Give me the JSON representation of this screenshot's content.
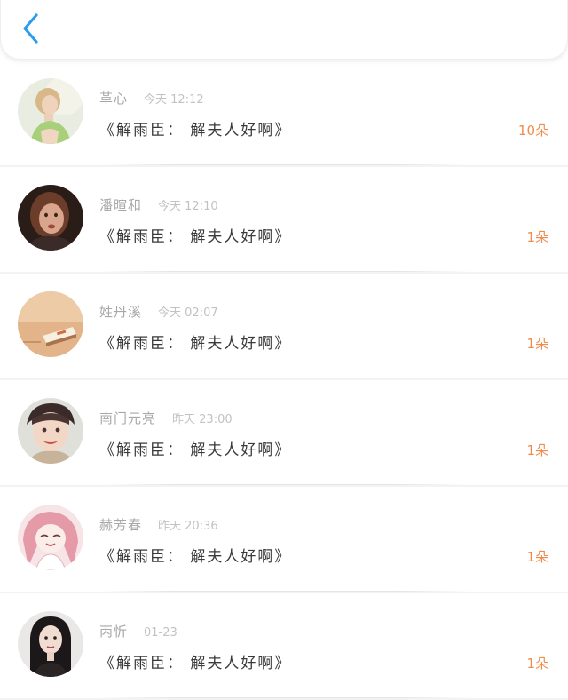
{
  "header": {
    "back_icon": "chevron-left-icon",
    "accent_color": "#2b9cf2"
  },
  "messages": [
    {
      "name": "革心",
      "time": "今天 12:12",
      "message": "《解雨臣： 解夫人好啊》",
      "count": "10朵"
    },
    {
      "name": "潘暄和",
      "time": "今天 12:10",
      "message": "《解雨臣： 解夫人好啊》",
      "count": "1朵"
    },
    {
      "name": "姓丹溪",
      "time": "今天 02:07",
      "message": "《解雨臣： 解夫人好啊》",
      "count": "1朵"
    },
    {
      "name": "南门元亮",
      "time": "昨天 23:00",
      "message": "《解雨臣： 解夫人好啊》",
      "count": "1朵"
    },
    {
      "name": "赫芳春",
      "time": "昨天 20:36",
      "message": "《解雨臣： 解夫人好啊》",
      "count": "1朵"
    },
    {
      "name": "丙忻",
      "time": "01-23",
      "message": "《解雨臣： 解夫人好啊》",
      "count": "1朵"
    }
  ],
  "colors": {
    "count": "#ef8c4c",
    "name": "#a8a8a8",
    "message": "#3a3a3a"
  }
}
